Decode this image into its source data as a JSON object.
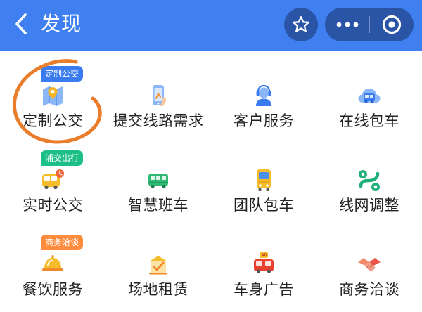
{
  "header": {
    "title": "发现",
    "background_color": "#3f7ff0",
    "button_color": "#2a55a6",
    "back_icon": "chevron-left-icon",
    "favorite_icon": "star-icon",
    "more_icon": "more-dots-icon",
    "close_icon": "close-circle-icon"
  },
  "services": [
    {
      "label": "定制公交",
      "badge": "定制公交",
      "badge_color": "blue",
      "icon": "bus-map-icon"
    },
    {
      "label": "提交线路需求",
      "badge": "",
      "icon": "phone-route-icon"
    },
    {
      "label": "客户服务",
      "badge": "",
      "icon": "customer-service-icon"
    },
    {
      "label": "在线包车",
      "badge": "",
      "icon": "cloud-bus-icon"
    },
    {
      "label": "实时公交",
      "badge": "浦交出行",
      "badge_color": "green",
      "icon": "realtime-bus-icon"
    },
    {
      "label": "智慧班车",
      "badge": "",
      "icon": "shuttle-bus-icon"
    },
    {
      "label": "团队包车",
      "badge": "",
      "icon": "team-bus-icon"
    },
    {
      "label": "线网调整",
      "badge": "",
      "icon": "route-map-icon"
    },
    {
      "label": "餐饮服务",
      "badge": "商务洽谈",
      "badge_color": "orange",
      "icon": "dining-icon"
    },
    {
      "label": "场地租赁",
      "badge": "",
      "icon": "venue-icon"
    },
    {
      "label": "车身广告",
      "badge": "",
      "icon": "bus-ad-icon"
    },
    {
      "label": "商务洽谈",
      "badge": "",
      "icon": "handshake-icon"
    }
  ],
  "annotation_color": "#ea7d2c"
}
